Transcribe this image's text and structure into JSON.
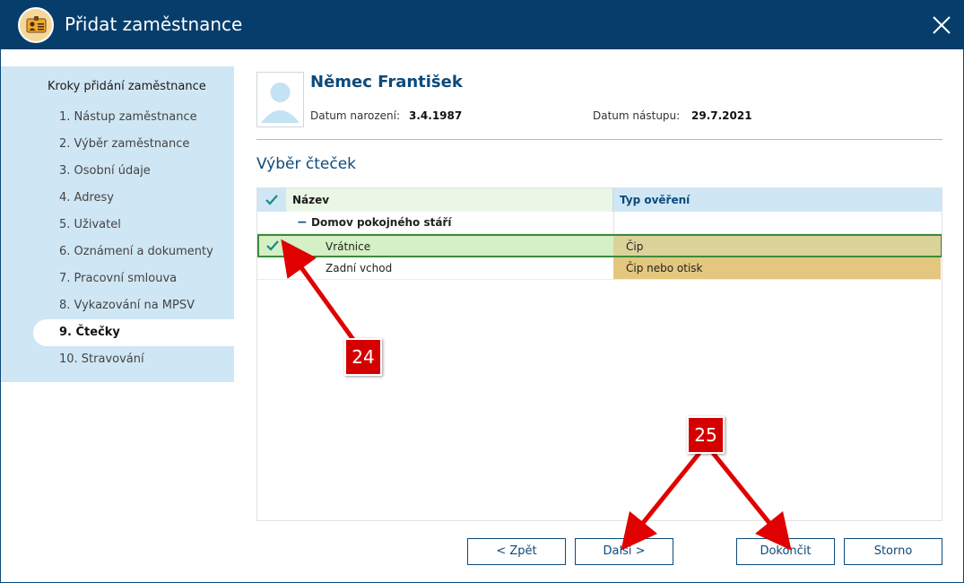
{
  "window": {
    "title": "Přidat zaměstnance",
    "close_icon": "close-icon"
  },
  "sidebar": {
    "title": "Kroky přidání zaměstnance",
    "steps": [
      {
        "label": "1. Nástup zaměstnance"
      },
      {
        "label": "2. Výběr zaměstnance"
      },
      {
        "label": "3. Osobní údaje"
      },
      {
        "label": "4. Adresy"
      },
      {
        "label": "5. Uživatel"
      },
      {
        "label": "6. Oznámení a dokumenty"
      },
      {
        "label": "7. Pracovní smlouva"
      },
      {
        "label": "8. Vykazování na MPSV"
      },
      {
        "label": "9. Čtečky"
      },
      {
        "label": "10. Stravování"
      }
    ],
    "active_step": "9. Čtečky"
  },
  "employee": {
    "name": "Němec František",
    "birth_label": "Datum narození:",
    "birth_value": "3.4.1987",
    "start_label": "Datum nástupu:",
    "start_value": "29.7.2021"
  },
  "section": {
    "title": "Výběr čteček"
  },
  "grid": {
    "headers": {
      "name": "Název",
      "type": "Typ ověření"
    },
    "group": {
      "label": "Domov pokojného stáří",
      "toggle": "−"
    },
    "rows": [
      {
        "name": "Vrátnice",
        "type": "Čip",
        "checked": true,
        "type_color": "#dcd39b"
      },
      {
        "name": "Zadní vchod",
        "type": "Čip nebo otisk",
        "checked": false,
        "type_color": "#e3c77e"
      }
    ]
  },
  "buttons": {
    "back": "< Zpět",
    "next": "Další >",
    "finish": "Dokončit",
    "cancel": "Storno"
  },
  "annotations": {
    "callout_a": "24",
    "callout_b": "25"
  },
  "colors": {
    "titlebar": "#063d6b",
    "accent": "#0d4a7a",
    "sidebar_bg": "#cfe6f4",
    "selected_row": "#d4f0c4",
    "callout": "#d40000",
    "check": "#1a8a8a"
  }
}
